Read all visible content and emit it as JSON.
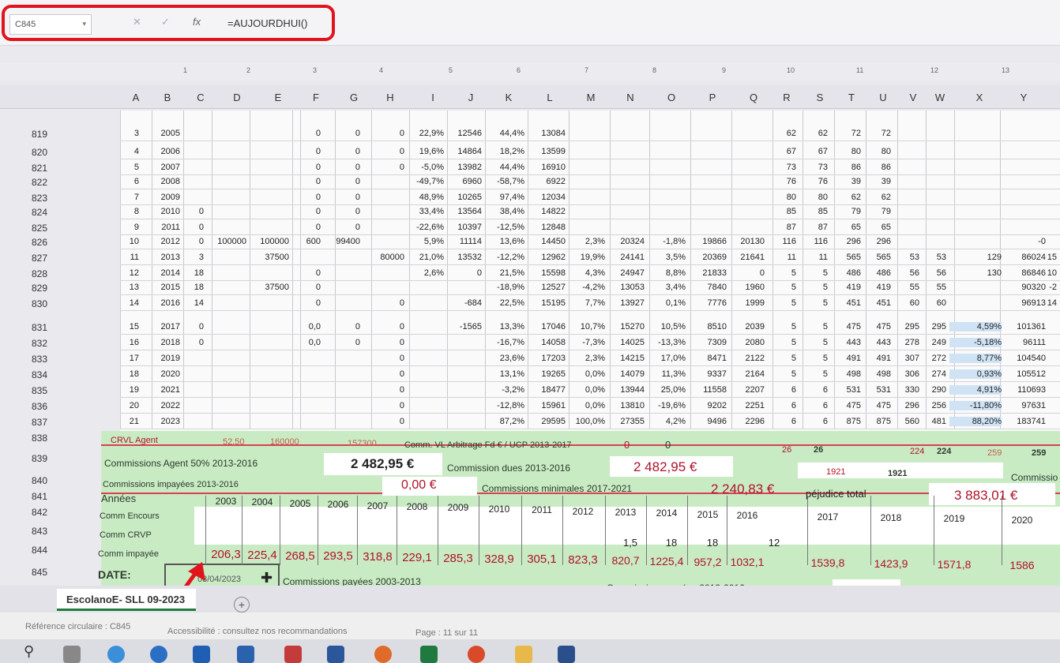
{
  "formula_bar": {
    "cell_ref": "C845",
    "formula": "=AUJOURDHUI()",
    "fx": "fx"
  },
  "columns": [
    "A",
    "B",
    "C",
    "D",
    "E",
    "F",
    "G",
    "H",
    "I",
    "J",
    "K",
    "L",
    "M",
    "N",
    "O",
    "P",
    "Q",
    "R",
    "S",
    "T",
    "U",
    "V",
    "W",
    "X",
    "Y"
  ],
  "ruler": [
    "1",
    "2",
    "3",
    "4",
    "5",
    "6",
    "7",
    "8",
    "9",
    "10",
    "11",
    "12",
    "13"
  ],
  "upper_rows": [
    {
      "r": "819",
      "a": "3",
      "b": "2005",
      "f": "0",
      "g": "0",
      "h": "0",
      "i": "22,9%",
      "j": "12546",
      "k": "44,4%",
      "l": "13084",
      "r_": "62",
      "s": "62",
      "t": "72",
      "u": "72"
    },
    {
      "r": "820",
      "a": "4",
      "b": "2006",
      "f": "0",
      "g": "0",
      "h": "0",
      "i": "19,6%",
      "j": "14864",
      "k": "18,2%",
      "l": "13599",
      "r_": "67",
      "s": "67",
      "t": "80",
      "u": "80"
    },
    {
      "r": "821",
      "a": "5",
      "b": "2007",
      "f": "0",
      "g": "0",
      "h": "0",
      "i": "-5,0%",
      "j": "13982",
      "k": "44,4%",
      "l": "16910",
      "r_": "73",
      "s": "73",
      "t": "86",
      "u": "86"
    },
    {
      "r": "822",
      "a": "6",
      "b": "2008",
      "f": "0",
      "g": "0",
      "i": "-49,7%",
      "j": "6960",
      "k": "-58,7%",
      "l": "6922",
      "r_": "76",
      "s": "76",
      "t": "39",
      "u": "39"
    },
    {
      "r": "823",
      "a": "7",
      "b": "2009",
      "f": "0",
      "g": "0",
      "i": "48,9%",
      "j": "10265",
      "k": "97,4%",
      "l": "12034",
      "r_": "80",
      "s": "80",
      "t": "62",
      "u": "62"
    },
    {
      "r": "824",
      "a": "8",
      "b": "2010",
      "c": "0",
      "f": "0",
      "g": "0",
      "i": "33,4%",
      "j": "13564",
      "k": "38,4%",
      "l": "14822",
      "r_": "85",
      "s": "85",
      "t": "79",
      "u": "79"
    },
    {
      "r": "825",
      "a": "9",
      "b": "2011",
      "c": "0",
      "f": "0",
      "g": "0",
      "i": "-22,6%",
      "j": "10397",
      "k": "-12,5%",
      "l": "12848",
      "r_": "87",
      "s": "87",
      "t": "65",
      "u": "65"
    },
    {
      "r": "826",
      "a": "10",
      "b": "2012",
      "c": "0",
      "d": "100000",
      "e": "100000",
      "f": "600",
      "g": "99400",
      "i": "5,9%",
      "j": "11114",
      "k": "13,6%",
      "l": "14450",
      "m": "2,3%",
      "n": "20324",
      "o": "-1,8%",
      "p": "19866",
      "q": "20130",
      "r_": "116",
      "s": "116",
      "t": "296",
      "u": "296",
      "y": "-0"
    },
    {
      "r": "827",
      "a": "11",
      "b": "2013",
      "c": "3",
      "e": "37500",
      "h": "80000",
      "i": "21,0%",
      "j": "13532",
      "k": "-12,2%",
      "l": "12962",
      "m": "19,9%",
      "n": "24141",
      "o": "3,5%",
      "p": "20369",
      "q": "21641",
      "r_": "11",
      "s": "11",
      "t": "565",
      "u": "565",
      "v": "53",
      "w": "53",
      "x": "129",
      "y": "86024",
      "z": "15"
    },
    {
      "r": "828",
      "a": "12",
      "b": "2014",
      "c": "18",
      "f": "0",
      "i": "2,6%",
      "j": "0",
      "k": "21,5%",
      "l": "15598",
      "m": "4,3%",
      "n": "24947",
      "o": "8,8%",
      "p": "21833",
      "q": "0",
      "r_": "5",
      "s": "5",
      "t": "486",
      "u": "486",
      "v": "56",
      "w": "56",
      "x": "130",
      "y": "86846",
      "z": "10"
    },
    {
      "r": "829",
      "a": "13",
      "b": "2015",
      "c": "18",
      "e": "37500",
      "f": "0",
      "k": "-18,9%",
      "l": "12527",
      "m": "-4,2%",
      "n": "13053",
      "o": "3,4%",
      "p": "7840",
      "q": "1960",
      "r_": "5",
      "s": "5",
      "t": "419",
      "u": "419",
      "v": "55",
      "w": "55",
      "y": "90320",
      "z": "-2"
    },
    {
      "r": "830",
      "a": "14",
      "b": "2016",
      "c": "14",
      "f": "0",
      "h": "0",
      "j": "-684",
      "k": "22,5%",
      "l": "15195",
      "m": "7,7%",
      "n": "13927",
      "o": "0,1%",
      "p": "7776",
      "q": "1999",
      "r_": "5",
      "s": "5",
      "t": "451",
      "u": "451",
      "v": "60",
      "w": "60",
      "y": "96913",
      "z": "14"
    }
  ],
  "lower_rows": [
    {
      "r": "831",
      "a": "15",
      "b": "2017",
      "c": "0",
      "f": "0,0",
      "g": "0",
      "h": "0",
      "j": "-1565",
      "k": "13,3%",
      "l": "17046",
      "m": "10,7%",
      "n": "15270",
      "o": "10,5%",
      "p": "8510",
      "q": "2039",
      "r_": "5",
      "s": "5",
      "t": "475",
      "u": "475",
      "v": "295",
      "w": "295",
      "x": "4,59%",
      "y": "101361"
    },
    {
      "r": "832",
      "a": "16",
      "b": "2018",
      "c": "0",
      "f": "0,0",
      "g": "0",
      "h": "0",
      "k": "-16,7%",
      "l": "14058",
      "m": "-7,3%",
      "n": "14025",
      "o": "-13,3%",
      "p": "7309",
      "q": "2080",
      "r_": "5",
      "s": "5",
      "t": "443",
      "u": "443",
      "v": "278",
      "w": "249",
      "x": "-5,18%",
      "y": "96111"
    },
    {
      "r": "833",
      "a": "17",
      "b": "2019",
      "h": "0",
      "k": "23,6%",
      "l": "17203",
      "m": "2,3%",
      "n": "14215",
      "o": "17,0%",
      "p": "8471",
      "q": "2122",
      "r_": "5",
      "s": "5",
      "t": "491",
      "u": "491",
      "v": "307",
      "w": "272",
      "x": "8,77%",
      "y": "104540"
    },
    {
      "r": "834",
      "a": "18",
      "b": "2020",
      "h": "0",
      "k": "13,1%",
      "l": "19265",
      "m": "0,0%",
      "n": "14079",
      "o": "11,3%",
      "p": "9337",
      "q": "2164",
      "r_": "5",
      "s": "5",
      "t": "498",
      "u": "498",
      "v": "306",
      "w": "274",
      "x": "0,93%",
      "y": "105512"
    },
    {
      "r": "835",
      "a": "19",
      "b": "2021",
      "h": "0",
      "k": "-3,2%",
      "l": "18477",
      "m": "0,0%",
      "n": "13944",
      "o": "25,0%",
      "p": "11558",
      "q": "2207",
      "r_": "6",
      "s": "6",
      "t": "531",
      "u": "531",
      "v": "330",
      "w": "290",
      "x": "4,91%",
      "y": "110693"
    },
    {
      "r": "836",
      "a": "20",
      "b": "2022",
      "h": "0",
      "k": "-12,8%",
      "l": "15961",
      "m": "0,0%",
      "n": "13810",
      "o": "-19,6%",
      "p": "9202",
      "q": "2251",
      "r_": "6",
      "s": "6",
      "t": "475",
      "u": "475",
      "v": "296",
      "w": "256",
      "x": "-11,80%",
      "y": "97631"
    },
    {
      "r": "837",
      "a": "21",
      "b": "2023",
      "h": "0",
      "k": "87,2%",
      "l": "29595",
      "m": "100,0%",
      "n": "27355",
      "o": "4,2%",
      "p": "9496",
      "q": "2296",
      "r_": "6",
      "s": "6",
      "t": "875",
      "u": "875",
      "v": "560",
      "w": "481",
      "x": "88,20%",
      "y": "183741"
    }
  ],
  "row838": {
    "r": "838",
    "label": "CRVL Agent",
    "d": "52,50",
    "e": "160000",
    "g": "157300",
    "comm": "Comm. VL Arbitrage Fd € / UCP 2013-2017",
    "n": "0",
    "o": "0",
    "s1": "26",
    "s2": "26",
    "v1": "224",
    "v2": "224",
    "x1": "259",
    "y1": "259"
  },
  "row839": {
    "r": "839",
    "label": "Commissions Agent 50% 2013-2016",
    "v1": "2 482,95 €",
    "label2": "Commission dues 2013-2016",
    "v2": "2 482,95 €",
    "s1": "1921",
    "s2": "1921",
    "label3": "Commissio"
  },
  "row840": {
    "r": "840",
    "label": "Commissions impayées 2013-2016",
    "v1": "0,00 €",
    "label2": "Commissions minimales 2017-2021",
    "v2": "2 240,83 €",
    "label3": "péjudice total",
    "v3": "3 883,01 €"
  },
  "row841": {
    "r": "841",
    "label": "Années",
    "years": [
      "2003",
      "2004",
      "2005",
      "2006",
      "2007",
      "2008",
      "2009",
      "2010",
      "2011",
      "2012",
      "2013",
      "2014",
      "2015",
      "2016",
      "2017",
      "2018",
      "2019",
      "2020"
    ]
  },
  "row842": {
    "r": "842",
    "label": "Comm Encours"
  },
  "row843": {
    "r": "843",
    "label": "Comm CRVP",
    "vals": [
      "1,5",
      "18",
      "18",
      "12"
    ]
  },
  "row844": {
    "r": "844",
    "label": "Comm impayée",
    "vals": [
      "206,3",
      "225,4",
      "268,5",
      "293,5",
      "318,8",
      "229,1",
      "285,3",
      "328,9",
      "305,1",
      "823,3",
      "820,7",
      "1225,4",
      "957,2",
      "1032,1",
      "1539,8",
      "1423,9",
      "1571,8",
      "1586"
    ]
  },
  "row845": {
    "r": "845",
    "label": "DATE:",
    "date": "03/04/2023",
    "label2": "Commissions payées 2003-2013",
    "label3": "Commissions payées 2013-2016",
    "v": "49,5"
  },
  "sheet_tab": "EscolanoE- SLL 09-2023",
  "status": {
    "circular": "Référence circulaire : C845",
    "accessibility": "Accessibilité : consultez nos recommandations",
    "page": "Page : 11 sur 11"
  }
}
